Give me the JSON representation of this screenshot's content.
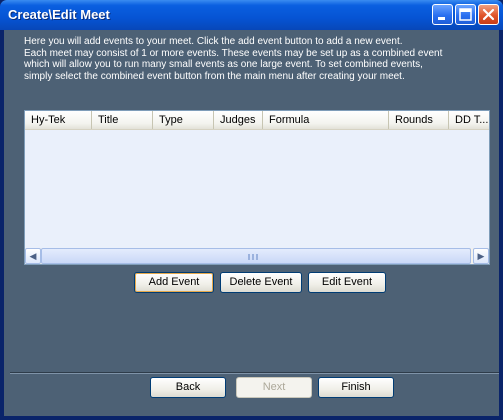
{
  "window": {
    "title": "Create\\Edit Meet",
    "controls": {
      "minimize": "minimize-icon",
      "maximize": "maximize-icon",
      "close": "close-icon"
    }
  },
  "intro_lines": [
    "Here you will add events to your meet. Click the add event button to add a new event.",
    "Each meet may consist of 1 or more events. These events may be set up as a combined event",
    "which will allow you to run many small events as one large event. To set combined events,",
    "simply select the combined event button from the main menu after creating your meet."
  ],
  "events_table": {
    "columns": [
      "Hy-Tek",
      "Title",
      "Type",
      "Judges",
      "Formula",
      "Rounds",
      "DD T..."
    ],
    "rows": []
  },
  "event_buttons": {
    "add": "Add Event",
    "delete": "Delete Event",
    "edit": "Edit Event"
  },
  "wizard_buttons": {
    "back": "Back",
    "next": "Next",
    "finish": "Finish"
  },
  "colors": {
    "titlebar": "#0654d4",
    "client_background": "#4d6175",
    "list_background": "#eaf0fb"
  }
}
